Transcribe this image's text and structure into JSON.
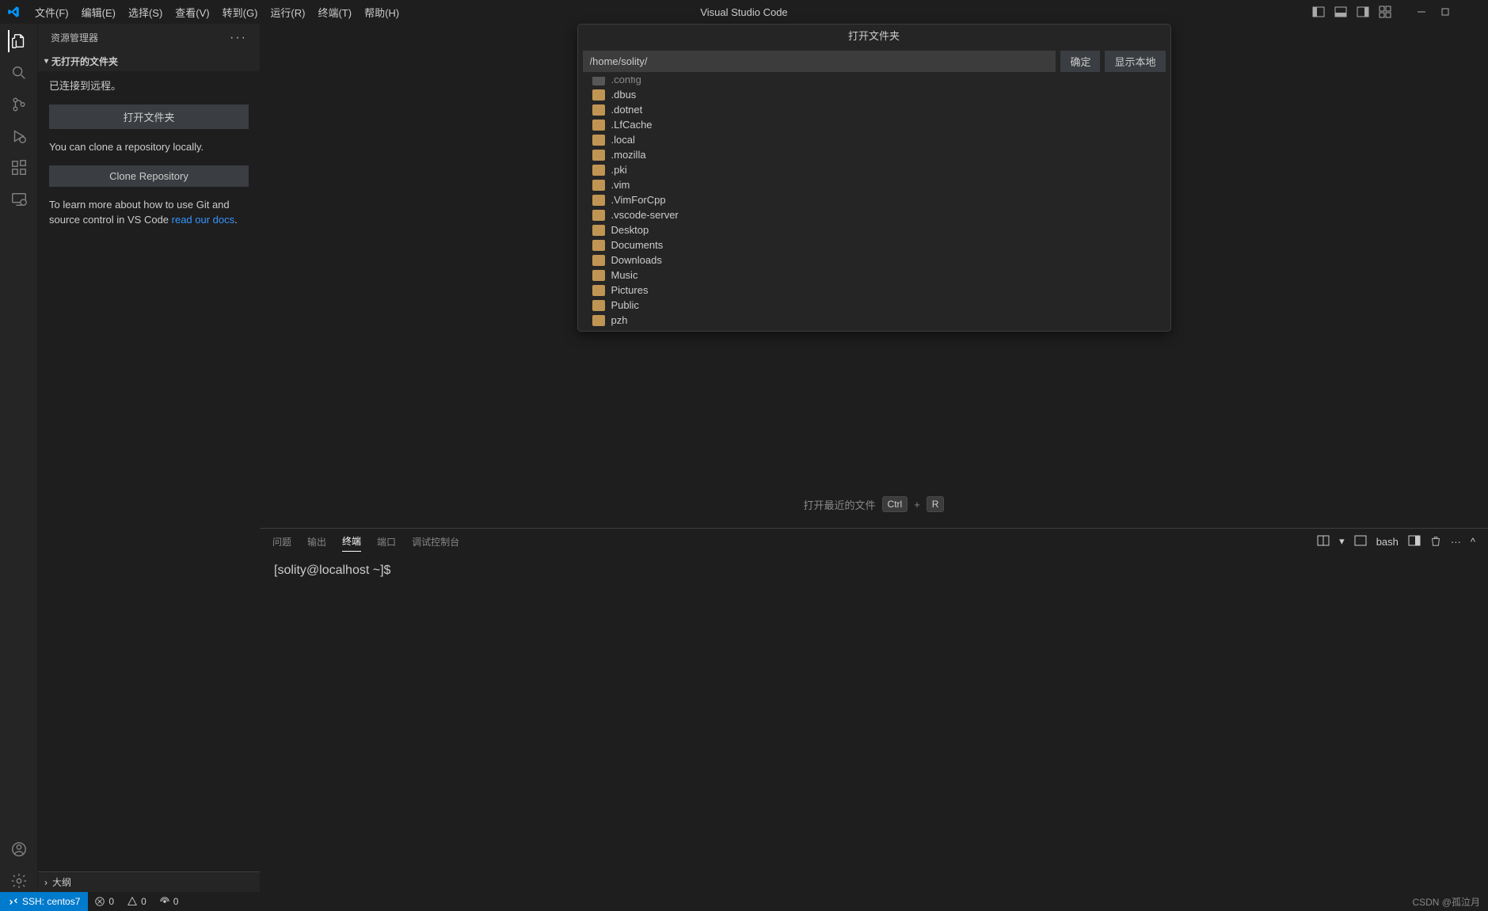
{
  "titlebar": {
    "menus": [
      "文件(F)",
      "编辑(E)",
      "选择(S)",
      "查看(V)",
      "转到(G)",
      "运行(R)",
      "终端(T)",
      "帮助(H)"
    ],
    "app_title": "Visual Studio Code"
  },
  "sidebar": {
    "header": "资源管理器",
    "section_title": "无打开的文件夹",
    "connected_text": "已连接到远程。",
    "open_folder_btn": "打开文件夹",
    "clone_hint": "You can clone a repository locally.",
    "clone_btn": "Clone Repository",
    "git_hint_prefix": "To learn more about how to use Git and source control in VS Code ",
    "git_link": "read our docs",
    "git_hint_suffix": ".",
    "outline": "大纲"
  },
  "quickopen": {
    "title": "打开文件夹",
    "path": "/home/solity/",
    "ok_btn": "确定",
    "local_btn": "显示本地",
    "folders": [
      ".config",
      ".dbus",
      ".dotnet",
      ".LfCache",
      ".local",
      ".mozilla",
      ".pki",
      ".vim",
      ".VimForCpp",
      ".vscode-server",
      "Desktop",
      "Documents",
      "Downloads",
      "Music",
      "Pictures",
      "Public",
      "pzh"
    ]
  },
  "recent": {
    "label": "打开最近的文件",
    "key1": "Ctrl",
    "plus": "+",
    "key2": "R"
  },
  "panel": {
    "tabs": [
      "问题",
      "输出",
      "终端",
      "端口",
      "调试控制台"
    ],
    "active_tab_index": 2,
    "shell_label": "bash",
    "terminal_prompt": "[solity@localhost ~]$ "
  },
  "statusbar": {
    "remote_label": "SSH: centos7",
    "errors": "0",
    "warnings": "0",
    "ports": "0",
    "watermark": "CSDN @孤泣月"
  }
}
